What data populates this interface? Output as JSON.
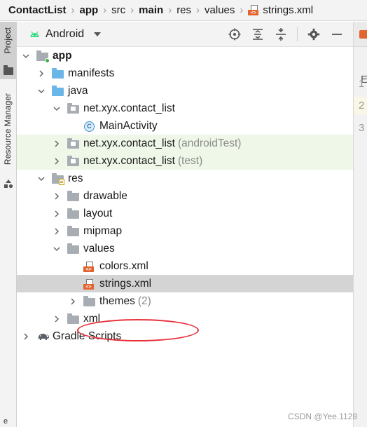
{
  "breadcrumb": {
    "items": [
      {
        "label": "ContactList",
        "bold": true
      },
      {
        "label": "app",
        "bold": true
      },
      {
        "label": "src",
        "bold": false
      },
      {
        "label": "main",
        "bold": true
      },
      {
        "label": "res",
        "bold": false
      },
      {
        "label": "values",
        "bold": false
      }
    ],
    "file": "strings.xml"
  },
  "tool_strip": {
    "project_label": "Project",
    "resource_manager_label": "Resource Manager"
  },
  "panel_header": {
    "view_mode": "Android",
    "icons": [
      "crosshair-icon",
      "expand-all-icon",
      "collapse-all-icon",
      "gear-icon",
      "minimize-icon"
    ]
  },
  "editor": {
    "tab_icon": "xml-file-icon",
    "hint_letter": "E",
    "line_numbers": [
      "1",
      "2",
      "3"
    ]
  },
  "tree": {
    "rows": [
      {
        "label": "app",
        "bold": true,
        "suffix": "",
        "icon": "module-folder-icon",
        "arrow": "down"
      },
      {
        "label": "manifests",
        "suffix": "",
        "icon": "folder-blue-icon",
        "arrow": "right"
      },
      {
        "label": "java",
        "suffix": "",
        "icon": "folder-blue-icon",
        "arrow": "down"
      },
      {
        "label": "net.xyx.contact_list",
        "suffix": "",
        "icon": "package-icon",
        "arrow": "down"
      },
      {
        "label": "MainActivity",
        "suffix": "",
        "icon": "class-icon",
        "arrow": "none"
      },
      {
        "label": "net.xyx.contact_list",
        "suffix": "(androidTest)",
        "icon": "package-icon",
        "arrow": "right",
        "tinted": true
      },
      {
        "label": "net.xyx.contact_list",
        "suffix": "(test)",
        "icon": "package-icon",
        "arrow": "right",
        "tinted": true
      },
      {
        "label": "res",
        "suffix": "",
        "icon": "resource-folder-icon",
        "arrow": "down"
      },
      {
        "label": "drawable",
        "suffix": "",
        "icon": "folder-gray-icon",
        "arrow": "right"
      },
      {
        "label": "layout",
        "suffix": "",
        "icon": "folder-gray-icon",
        "arrow": "right"
      },
      {
        "label": "mipmap",
        "suffix": "",
        "icon": "folder-gray-icon",
        "arrow": "right"
      },
      {
        "label": "values",
        "suffix": "",
        "icon": "folder-gray-icon",
        "arrow": "down"
      },
      {
        "label": "colors.xml",
        "suffix": "",
        "icon": "xml-file-icon",
        "arrow": "none"
      },
      {
        "label": "strings.xml",
        "suffix": "",
        "icon": "xml-file-icon",
        "arrow": "none",
        "selected": true
      },
      {
        "label": "themes",
        "suffix": "(2)",
        "icon": "folder-gray-icon",
        "arrow": "right"
      },
      {
        "label": "xml",
        "suffix": "",
        "icon": "folder-gray-icon",
        "arrow": "right"
      },
      {
        "label": "Gradle Scripts",
        "suffix": "",
        "icon": "gradle-elephant-icon",
        "arrow": "right"
      }
    ]
  },
  "annotation": {
    "color": "#e8313a",
    "target": "strings.xml"
  },
  "watermark": "CSDN @Yee.1128",
  "colors": {
    "selection": "#d4d4d4",
    "test_tint": "#eff7e8",
    "folder_blue": "#6bb6e8",
    "folder_gray": "#a8adb3",
    "xml_orange": "#e0652f"
  }
}
